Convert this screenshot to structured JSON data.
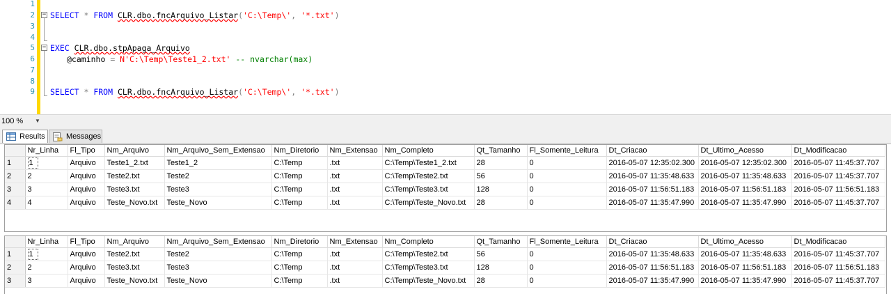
{
  "editor": {
    "line_numbers": [
      "1",
      "2",
      "3",
      "4",
      "5",
      "6",
      "7",
      "8",
      "9"
    ],
    "line2": {
      "kw1": "SELECT",
      "star": " * ",
      "kw2": "FROM",
      "obj": "CLR.dbo.fncArquivo_Listar",
      "p1": "(",
      "s1": "'C:\\Temp\\'",
      "comma": ", ",
      "s2": "'*.txt'",
      "p2": ")"
    },
    "line5": {
      "kw": "EXEC",
      "obj": "CLR.dbo.stpApaga_Arquivo"
    },
    "line6": {
      "param": "@caminho",
      "eq": " = ",
      "str": "N'C:\\Temp\\Teste1_2.txt'",
      "cmt": "-- nvarchar(max)"
    },
    "line9": {
      "kw1": "SELECT",
      "star": " * ",
      "kw2": "FROM",
      "obj": "CLR.dbo.fncArquivo_Listar",
      "p1": "(",
      "s1": "'C:\\Temp\\'",
      "comma": ", ",
      "s2": "'*.txt'",
      "p2": ")"
    }
  },
  "zoom": {
    "value": "100 %"
  },
  "tabs": {
    "results": "Results",
    "messages": "Messages"
  },
  "columns": [
    "Nr_Linha",
    "Fl_Tipo",
    "Nm_Arquivo",
    "Nm_Arquivo_Sem_Extensao",
    "Nm_Diretorio",
    "Nm_Extensao",
    "Nm_Completo",
    "Qt_Tamanho",
    "Fl_Somente_Leitura",
    "Dt_Criacao",
    "Dt_Ultimo_Acesso",
    "Dt_Modificacao"
  ],
  "grid1": [
    [
      "1",
      "1",
      "Arquivo",
      "Teste1_2.txt",
      "Teste1_2",
      "C:\\Temp",
      ".txt",
      "C:\\Temp\\Teste1_2.txt",
      "28",
      "0",
      "2016-05-07 12:35:02.300",
      "2016-05-07 12:35:02.300",
      "2016-05-07 11:45:37.707"
    ],
    [
      "2",
      "2",
      "Arquivo",
      "Teste2.txt",
      "Teste2",
      "C:\\Temp",
      ".txt",
      "C:\\Temp\\Teste2.txt",
      "56",
      "0",
      "2016-05-07 11:35:48.633",
      "2016-05-07 11:35:48.633",
      "2016-05-07 11:45:37.707"
    ],
    [
      "3",
      "3",
      "Arquivo",
      "Teste3.txt",
      "Teste3",
      "C:\\Temp",
      ".txt",
      "C:\\Temp\\Teste3.txt",
      "128",
      "0",
      "2016-05-07 11:56:51.183",
      "2016-05-07 11:56:51.183",
      "2016-05-07 11:56:51.183"
    ],
    [
      "4",
      "4",
      "Arquivo",
      "Teste_Novo.txt",
      "Teste_Novo",
      "C:\\Temp",
      ".txt",
      "C:\\Temp\\Teste_Novo.txt",
      "28",
      "0",
      "2016-05-07 11:35:47.990",
      "2016-05-07 11:35:47.990",
      "2016-05-07 11:45:37.707"
    ]
  ],
  "grid2": [
    [
      "1",
      "1",
      "Arquivo",
      "Teste2.txt",
      "Teste2",
      "C:\\Temp",
      ".txt",
      "C:\\Temp\\Teste2.txt",
      "56",
      "0",
      "2016-05-07 11:35:48.633",
      "2016-05-07 11:35:48.633",
      "2016-05-07 11:45:37.707"
    ],
    [
      "2",
      "2",
      "Arquivo",
      "Teste3.txt",
      "Teste3",
      "C:\\Temp",
      ".txt",
      "C:\\Temp\\Teste3.txt",
      "128",
      "0",
      "2016-05-07 11:56:51.183",
      "2016-05-07 11:56:51.183",
      "2016-05-07 11:56:51.183"
    ],
    [
      "3",
      "3",
      "Arquivo",
      "Teste_Novo.txt",
      "Teste_Novo",
      "C:\\Temp",
      ".txt",
      "C:\\Temp\\Teste_Novo.txt",
      "28",
      "0",
      "2016-05-07 11:35:47.990",
      "2016-05-07 11:35:47.990",
      "2016-05-07 11:45:37.707"
    ]
  ]
}
